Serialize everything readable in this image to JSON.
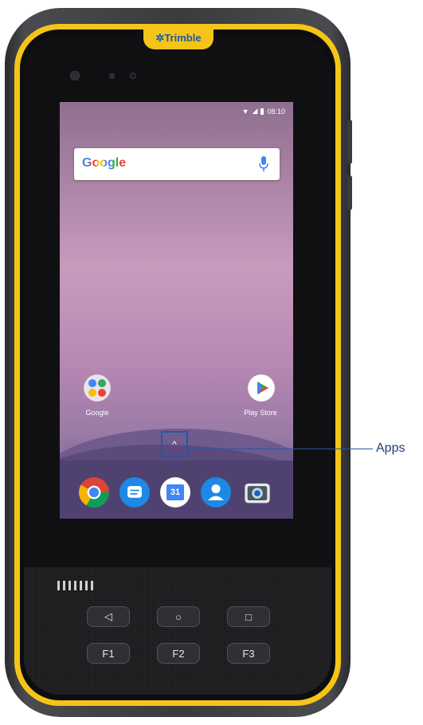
{
  "device": {
    "brand": "Trimble"
  },
  "status_bar": {
    "time": "08:10"
  },
  "search_widget": {
    "logo_text": "Google"
  },
  "home_apps": [
    {
      "label": "Google"
    },
    {
      "label": "Play Store"
    }
  ],
  "dock": {
    "apps_indicator": "^",
    "calendar_day": "31"
  },
  "callout": {
    "label": "Apps"
  },
  "hardware_keys": {
    "back": "◁",
    "home": "○",
    "recents": "□",
    "f1": "F1",
    "f2": "F2",
    "f3": "F3"
  },
  "colors": {
    "bumper": "#f4c419",
    "callout": "#1e5aa8"
  }
}
